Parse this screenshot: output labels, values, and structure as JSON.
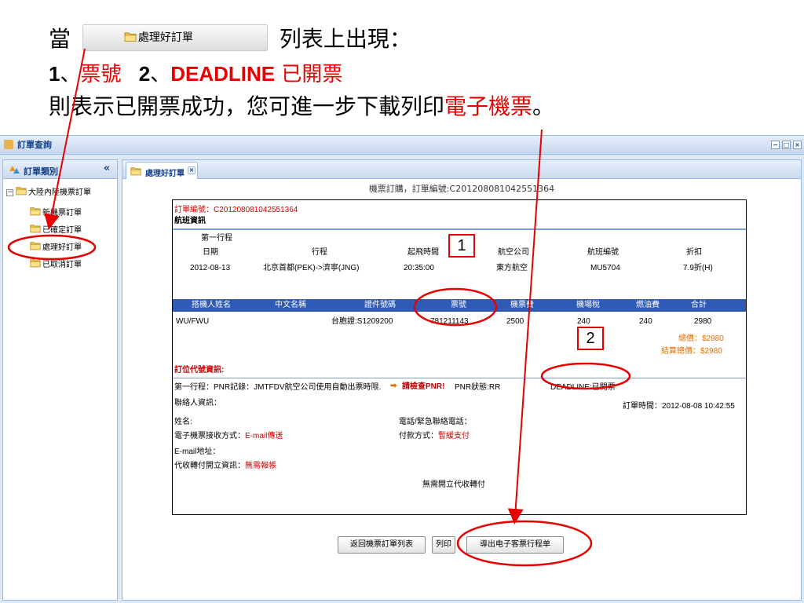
{
  "instructions": {
    "line1_prefix": "當",
    "line1_tab_label": "處理好訂單",
    "line1_suffix": "列表上出現：",
    "line2_n1": "1",
    "line2_sep1": "、",
    "line2_ticket": "票號",
    "line2_n2": "2",
    "line2_sep2": "、",
    "line2_deadline": "DEADLINE",
    "line2_issued": "已開票",
    "line3_prefix": "則表示已開票成功，您可進一步下載列印",
    "line3_eticket": "電子機票",
    "line3_suffix": "。"
  },
  "window": {
    "title": "訂單查詢",
    "controls": [
      "−",
      "□",
      "×"
    ]
  },
  "sidebar": {
    "header": "訂單類別",
    "collapse": "«",
    "root": {
      "toggle": "−",
      "label": "大陸內陸機票訂單"
    },
    "items": [
      {
        "label": "新機票訂單"
      },
      {
        "label": "已確定訂單"
      },
      {
        "label": "處理好訂單"
      },
      {
        "label": "已取消訂單"
      }
    ]
  },
  "tab": {
    "label": "處理好訂單",
    "close": "×"
  },
  "content": {
    "title": "機票訂購，訂單編號:C201208081042551364",
    "order_no_line": "訂單編號：C201208081042551364",
    "flight_section": "航班資訊",
    "trip_label": "第一行程",
    "flight_headers": [
      "日期",
      "行程",
      "起飛時間",
      "航空公司",
      "航班編號",
      "折扣"
    ],
    "flight_row": [
      "2012-08-13",
      "北京首都(PEK)->濟寧(JNG)",
      "20:35:00",
      "東方航空",
      "MU5704",
      "7.9折(H)"
    ],
    "pax_headers": [
      "搭機人姓名",
      "中文名稱",
      "證件號碼",
      "票號",
      "機票費",
      "機場稅",
      "燃油費",
      "合計"
    ],
    "pax_row": [
      "WU/FWU",
      "",
      "台胞證:S1209200",
      "781211143",
      "2500",
      "240",
      "240",
      "2980"
    ],
    "total_price": "總價：$2980",
    "settle_price": "結算總價：$2980",
    "booking_section": "訂位代號資訊:",
    "pnr_line": "第一行程：PNR記錄：JMTFDV航空公司使用自動出票時限.",
    "pnr_check": "請檢查PNR!",
    "pnr_status": "PNR狀態:RR",
    "deadline_status": "DEADLINE:已開票",
    "contact_label": "聯絡人資訊：",
    "order_time": "訂單時間：2012-08-08 10:42:55",
    "name_label": "姓名:",
    "phone_label": "電話/緊急聯絡電話：",
    "eticket_method_label": "電子機票接收方式：",
    "eticket_method_value": "E-mail傳送",
    "payment_label": "付款方式：",
    "payment_value": "暫緩支付",
    "email_label": "E-mail地址：",
    "collect_label": "代收轉付開立資訊：",
    "collect_value": "無需報帳",
    "collect_note": "無需開立代收轉付"
  },
  "buttons": {
    "back": "返回機票訂單列表",
    "print": "列印",
    "export": "導出电子客票行程单"
  },
  "annotations": {
    "marker1": "1",
    "marker2": "2",
    "color": "#e60000"
  },
  "colors": {
    "accent_red": "#e60000",
    "header_blue": "#2f5bb7",
    "panel_blue": "#dfe8f6",
    "title_blue": "#15428b"
  }
}
